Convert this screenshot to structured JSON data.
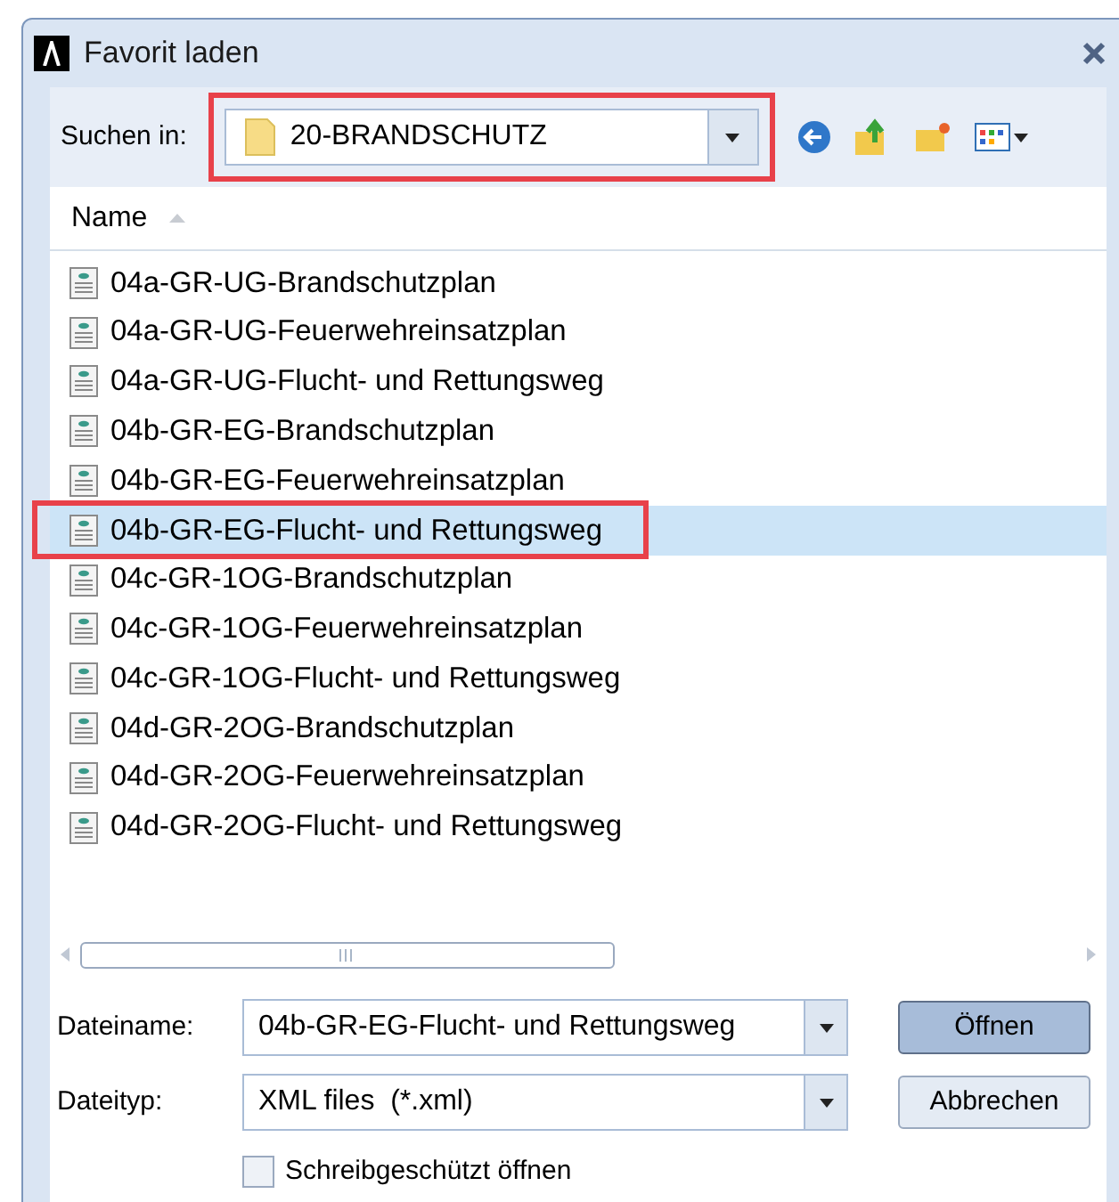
{
  "window": {
    "title": "Favorit laden"
  },
  "location": {
    "label": "Suchen in:",
    "value": "20-BRANDSCHUTZ",
    "highlighted": true
  },
  "list": {
    "column": "Name",
    "items": [
      {
        "name": "04a-GR-UG-Brandschutzplan",
        "selected": false,
        "highlighted": false
      },
      {
        "name": "04a-GR-UG-Feuerwehreinsatzplan",
        "selected": false,
        "highlighted": false
      },
      {
        "name": "04a-GR-UG-Flucht- und Rettungsweg",
        "selected": false,
        "highlighted": false
      },
      {
        "name": "04b-GR-EG-Brandschutzplan",
        "selected": false,
        "highlighted": false
      },
      {
        "name": "04b-GR-EG-Feuerwehreinsatzplan",
        "selected": false,
        "highlighted": false
      },
      {
        "name": "04b-GR-EG-Flucht- und Rettungsweg",
        "selected": true,
        "highlighted": true
      },
      {
        "name": "04c-GR-1OG-Brandschutzplan",
        "selected": false,
        "highlighted": false
      },
      {
        "name": "04c-GR-1OG-Feuerwehreinsatzplan",
        "selected": false,
        "highlighted": false
      },
      {
        "name": "04c-GR-1OG-Flucht- und Rettungsweg",
        "selected": false,
        "highlighted": false
      },
      {
        "name": "04d-GR-2OG-Brandschutzplan",
        "selected": false,
        "highlighted": false
      },
      {
        "name": "04d-GR-2OG-Feuerwehreinsatzplan",
        "selected": false,
        "highlighted": false
      },
      {
        "name": "04d-GR-2OG-Flucht- und Rettungsweg",
        "selected": false,
        "highlighted": false
      }
    ]
  },
  "filename": {
    "label": "Dateiname:",
    "value": "04b-GR-EG-Flucht- und Rettungsweg"
  },
  "filetype": {
    "label": "Dateityp:",
    "value": "XML files  (*.xml)"
  },
  "readonly": {
    "label": "Schreibgeschützt öffnen",
    "checked": false
  },
  "buttons": [
    {
      "label": "Öffnen",
      "default": true
    },
    {
      "label": "Abbrechen",
      "default": false
    }
  ]
}
